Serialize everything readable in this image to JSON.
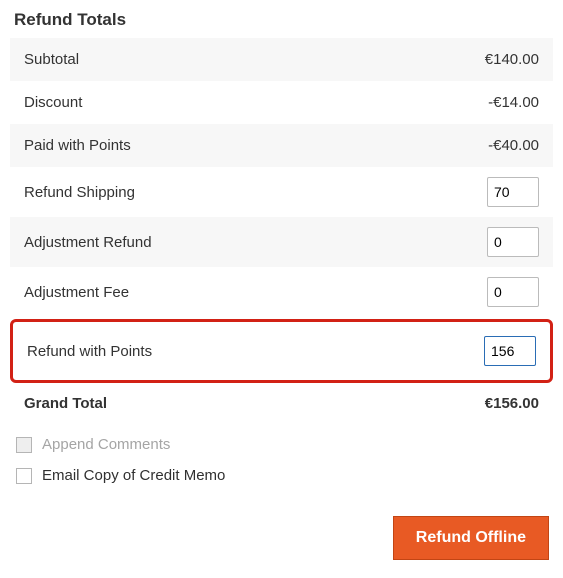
{
  "title": "Refund Totals",
  "currency": "€",
  "rows": {
    "subtotal": {
      "label": "Subtotal",
      "value": "€140.00"
    },
    "discount": {
      "label": "Discount",
      "value": "-€14.00"
    },
    "paid_with_points": {
      "label": "Paid with Points",
      "value": "-€40.00"
    },
    "refund_shipping": {
      "label": "Refund Shipping",
      "input": "70"
    },
    "adjustment_refund": {
      "label": "Adjustment Refund",
      "input": "0"
    },
    "adjustment_fee": {
      "label": "Adjustment Fee",
      "input": "0"
    },
    "refund_with_points": {
      "label": "Refund with Points",
      "input": "156"
    },
    "grand_total": {
      "label": "Grand Total",
      "value": "€156.00"
    }
  },
  "checkboxes": {
    "append_comments": {
      "label": "Append Comments",
      "checked": false,
      "disabled": true
    },
    "email_copy": {
      "label": "Email Copy of Credit Memo",
      "checked": false,
      "disabled": false
    }
  },
  "buttons": {
    "refund_offline": "Refund Offline"
  }
}
